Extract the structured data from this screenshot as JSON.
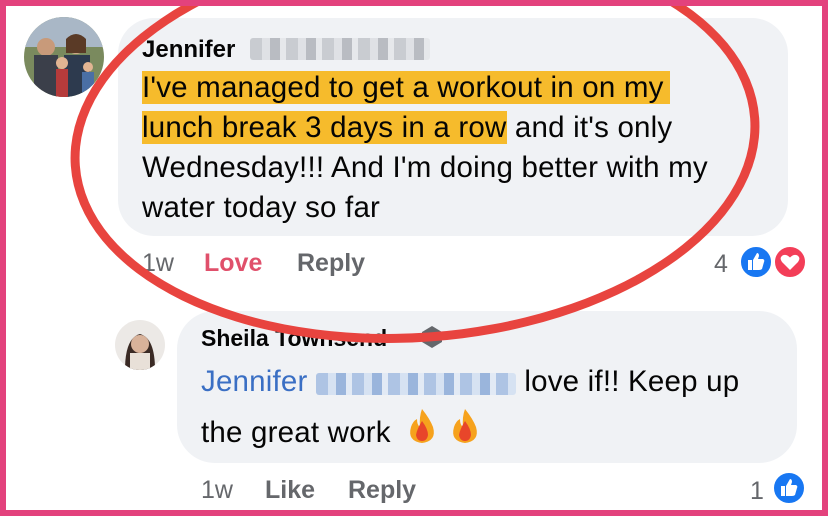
{
  "comment": {
    "author_first": "Jennifer",
    "line1": "I've managed to get a workout in on my",
    "line2_highlight": "lunch break 3 days in a row",
    "line2_rest": " and it's only",
    "line3": "Wednesday!!! And I'm doing better with my",
    "line4": "water today so far",
    "time": "1w",
    "love_label": "Love",
    "reply_label": "Reply",
    "reaction_count": "4",
    "reaction_icons": [
      "like-icon",
      "love-icon"
    ]
  },
  "reply": {
    "author": "Sheila Townsend",
    "mention_first": "Jennifer",
    "text_after_mention": " love if!! Keep up",
    "line2": "the great work",
    "emojis": [
      "fire-emoji",
      "fire-emoji"
    ],
    "time": "1w",
    "like_label": "Like",
    "reply_label": "Reply",
    "reaction_count": "1",
    "reaction_icons": [
      "like-icon"
    ]
  },
  "colors": {
    "frame": "#e3427d",
    "circle": "#e8443f",
    "highlight": "#f6bb2c",
    "bubble": "#f0f2f5",
    "like_blue": "#1877f2",
    "love_red": "#f33e58"
  }
}
